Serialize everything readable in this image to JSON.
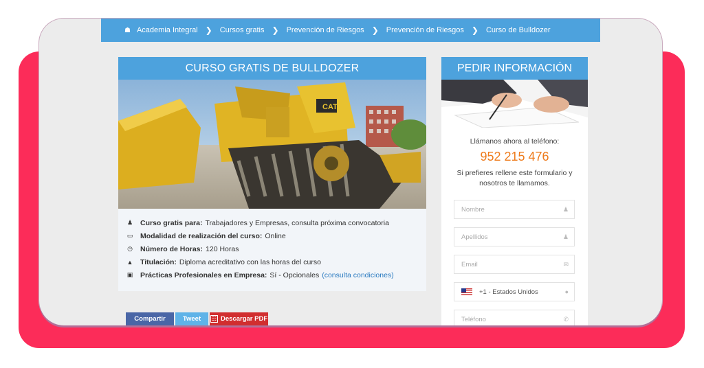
{
  "breadcrumb": {
    "items": [
      "Academia Integral",
      "Cursos gratis",
      "Prevención de Riesgos",
      "Prevención de Riesgos",
      "Curso de Bulldozer"
    ]
  },
  "course": {
    "title": "CURSO GRATIS DE BULLDOZER",
    "details": [
      {
        "icon": "user-icon",
        "label": "Curso gratis para:",
        "value": "Trabajadores y Empresas, consulta próxima convocatoria"
      },
      {
        "icon": "laptop-icon",
        "label": "Modalidad de realización del curso:",
        "value": "Online"
      },
      {
        "icon": "clock-icon",
        "label": "Número de Horas:",
        "value": "120 Horas"
      },
      {
        "icon": "graduation-cap-icon",
        "label": "Titulación:",
        "value": "Diploma acreditativo con las horas del curso"
      },
      {
        "icon": "briefcase-icon",
        "label": "Prácticas Profesionales en Empresa:",
        "value": "Sí - Opcionales",
        "link": "(consulta condiciones)"
      }
    ],
    "share": {
      "facebook": "Compartir",
      "twitter": "Tweet",
      "pdf": "Descargar PDF"
    }
  },
  "info_panel": {
    "title": "PEDIR INFORMACIÓN",
    "call_text": "Llámanos ahora al teléfono:",
    "phone": "952 215 476",
    "note": "Si prefieres rellene este formulario y nosotros te llamamos.",
    "fields": {
      "nombre": "Nombre",
      "apellidos": "Apellidos",
      "email": "Email",
      "country": "+1 - Estados Unidos",
      "telefono": "Teléfono"
    }
  },
  "colors": {
    "accent": "#4da2dd",
    "phone": "#ee7b1c",
    "background_red": "#fc2c59"
  }
}
